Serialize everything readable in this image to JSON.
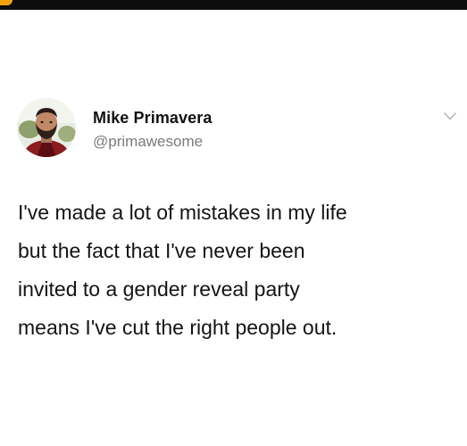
{
  "tweet": {
    "author": {
      "name": "Mike Primavera",
      "handle": "@primawesome"
    },
    "text_lines": [
      "I've made a lot of mistakes in my life",
      "but the fact that I've never been",
      "invited to a gender reveal party",
      "means I've cut the right people out."
    ]
  },
  "icons": {
    "menu": "chevron-down-icon",
    "avatar": "profile-photo"
  },
  "colors": {
    "top_bar": "#0d0d0d",
    "top_bar_accent": "#f2a20c",
    "name": "#111111",
    "handle": "#7a7a7a",
    "body_text": "#141414",
    "chevron": "#b9b9b9"
  }
}
